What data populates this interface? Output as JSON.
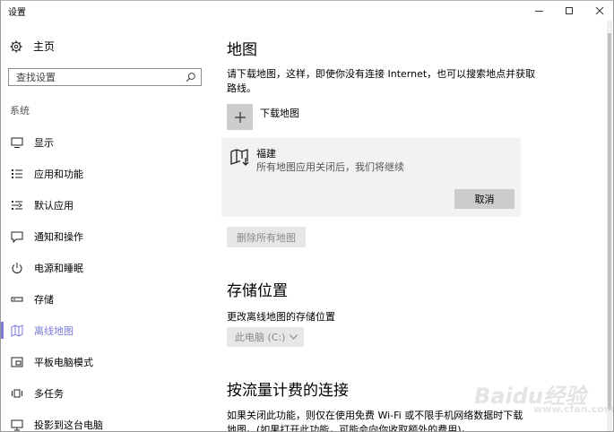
{
  "window": {
    "title": "设置",
    "minimize_icon": "minimize-icon",
    "maximize_icon": "maximize-icon",
    "close_icon": "close-icon"
  },
  "sidebar": {
    "home": {
      "label": "主页",
      "icon": "gear-icon"
    },
    "search": {
      "placeholder": "查找设置",
      "icon": "search-icon"
    },
    "section": "系统",
    "items": [
      {
        "label": "显示",
        "icon": "display-icon",
        "active": false
      },
      {
        "label": "应用和功能",
        "icon": "apps-list-icon",
        "active": false
      },
      {
        "label": "默认应用",
        "icon": "default-apps-icon",
        "active": false
      },
      {
        "label": "通知和操作",
        "icon": "notification-icon",
        "active": false
      },
      {
        "label": "电源和睡眠",
        "icon": "power-icon",
        "active": false
      },
      {
        "label": "存储",
        "icon": "storage-icon",
        "active": false
      },
      {
        "label": "离线地图",
        "icon": "map-icon",
        "active": true
      },
      {
        "label": "平板电脑模式",
        "icon": "tablet-icon",
        "active": false
      },
      {
        "label": "多任务",
        "icon": "multitask-icon",
        "active": false
      },
      {
        "label": "投影到这台电脑",
        "icon": "project-icon",
        "active": false
      }
    ],
    "accent_color": "#7a7ad8"
  },
  "main": {
    "title": "地图",
    "description": "请下载地图，这样，即使你没有连接 Internet，也可以搜索地点并获取路线。",
    "download": {
      "label": "下载地图",
      "icon": "plus-icon"
    },
    "download_item": {
      "name": "福建",
      "status": "所有地图应用关闭后，我们将继续",
      "cancel_label": "取消",
      "icon": "map-download-icon"
    },
    "delete_all_label": "删除所有地图",
    "storage": {
      "title": "存储位置",
      "subtitle": "更改离线地图的存储位置",
      "selected": "此电脑 (C:)"
    },
    "metered": {
      "title": "按流量计费的连接",
      "description": "如果关闭此功能，则仅在使用免费 Wi-Fi 或不限手机网络数据时下载地图。(如果打开此功能，可能会向你收取额外的费用)。"
    }
  },
  "watermark": {
    "text": "Baidu经验",
    "sub": "www.cfan.com.cn"
  }
}
